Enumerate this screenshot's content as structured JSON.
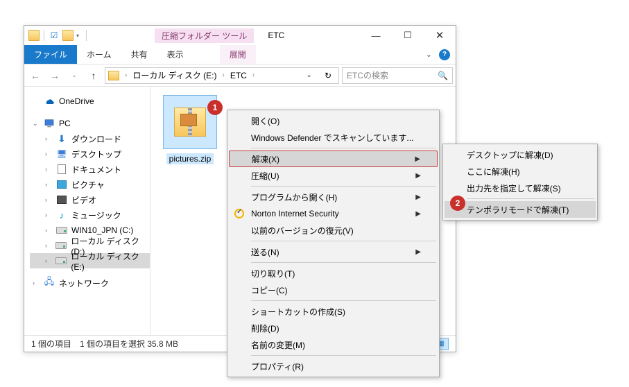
{
  "window": {
    "contextual_label": "圧縮フォルダー ツール",
    "title": "ETC"
  },
  "ribbon": {
    "file": "ファイル",
    "home": "ホーム",
    "share": "共有",
    "view": "表示",
    "contextual": "展開"
  },
  "address": {
    "seg1": "ローカル ディスク (E:)",
    "seg2": "ETC"
  },
  "search": {
    "placeholder": "ETCの検索"
  },
  "nav": {
    "onedrive": "OneDrive",
    "pc": "PC",
    "downloads": "ダウンロード",
    "desktop": "デスクトップ",
    "documents": "ドキュメント",
    "pictures": "ピクチャ",
    "videos": "ビデオ",
    "music": "ミュージック",
    "drive_c": "WIN10_JPN (C:)",
    "drive_d": "ローカル ディスク (D:)",
    "drive_e": "ローカル ディスク (E:)",
    "network": "ネットワーク"
  },
  "file": {
    "name": "pictures.zip"
  },
  "status": {
    "count": "1 個の項目",
    "selection": "1 個の項目を選択 35.8 MB"
  },
  "ctx": {
    "open": "開く(O)",
    "defender": "Windows Defender でスキャンしています...",
    "extract": "解凍(X)",
    "compress": "圧縮(U)",
    "openwith": "プログラムから開く(H)",
    "norton": "Norton Internet Security",
    "prevver": "以前のバージョンの復元(V)",
    "sendto": "送る(N)",
    "cut": "切り取り(T)",
    "copy": "コピー(C)",
    "shortcut": "ショートカットの作成(S)",
    "delete": "削除(D)",
    "rename": "名前の変更(M)",
    "properties": "プロパティ(R)"
  },
  "sub": {
    "desktop": "デスクトップに解凍(D)",
    "here": "ここに解凍(H)",
    "specify": "出力先を指定して解凍(S)",
    "temp": "テンポラリモードで解凍(T)"
  },
  "badges": {
    "b1": "1",
    "b2": "2"
  }
}
